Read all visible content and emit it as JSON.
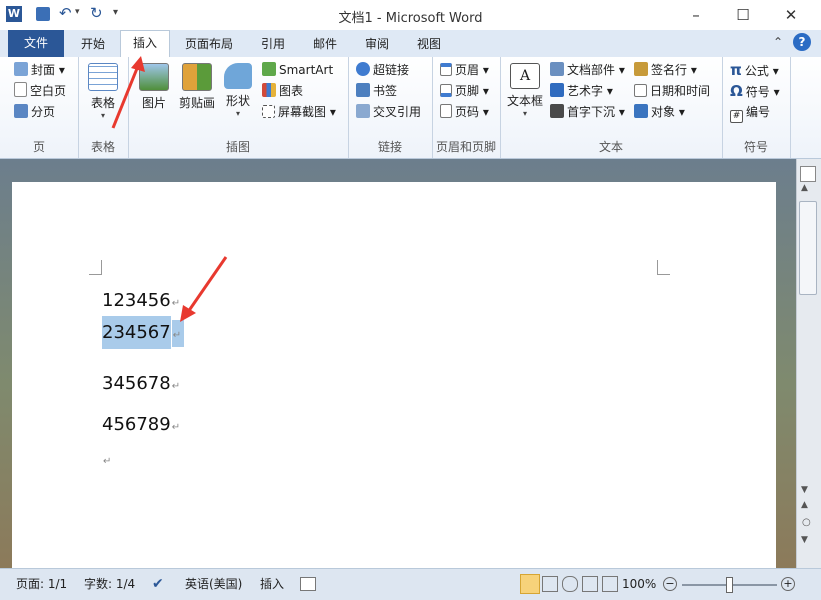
{
  "titlebar": {
    "title": "文档1 - Microsoft Word",
    "qat_customize": "▾",
    "minimize": "–",
    "maximize": "☐",
    "close": "✕"
  },
  "tabs": [
    "文件",
    "开始",
    "插入",
    "页面布局",
    "引用",
    "邮件",
    "审阅",
    "视图"
  ],
  "ribbon": {
    "pages": {
      "label": "页",
      "items": [
        "封面",
        "空白页",
        "分页"
      ]
    },
    "tables": {
      "label": "表格",
      "button": "表格"
    },
    "illustrations": {
      "label": "插图",
      "picture": "图片",
      "clipart": "剪贴画",
      "shapes": "形状",
      "smartart": "SmartArt",
      "chart": "图表",
      "screenshot": "屏幕截图"
    },
    "links": {
      "label": "链接",
      "items": [
        "超链接",
        "书签",
        "交叉引用"
      ]
    },
    "header_footer": {
      "label": "页眉和页脚",
      "items": [
        "页眉",
        "页脚",
        "页码"
      ]
    },
    "text": {
      "label": "文本",
      "textbox": "文本框",
      "items_col1": [
        "文档部件",
        "艺术字",
        "首字下沉"
      ],
      "items_col2": [
        "签名行",
        "日期和时间",
        "对象"
      ]
    },
    "symbols": {
      "label": "符号",
      "items": [
        "公式",
        "符号",
        "编号"
      ]
    }
  },
  "document": {
    "lines": [
      "123456",
      "234567",
      "345678",
      "456789"
    ],
    "para_mark": "↵"
  },
  "statusbar": {
    "page": "页面: 1/1",
    "words": "字数: 1/4",
    "language": "英语(美国)",
    "mode": "插入",
    "zoom": "100%"
  },
  "colors": {
    "file_tab": "#2b5797",
    "selection": "#a9cbea",
    "arrow": "#e8392f"
  }
}
